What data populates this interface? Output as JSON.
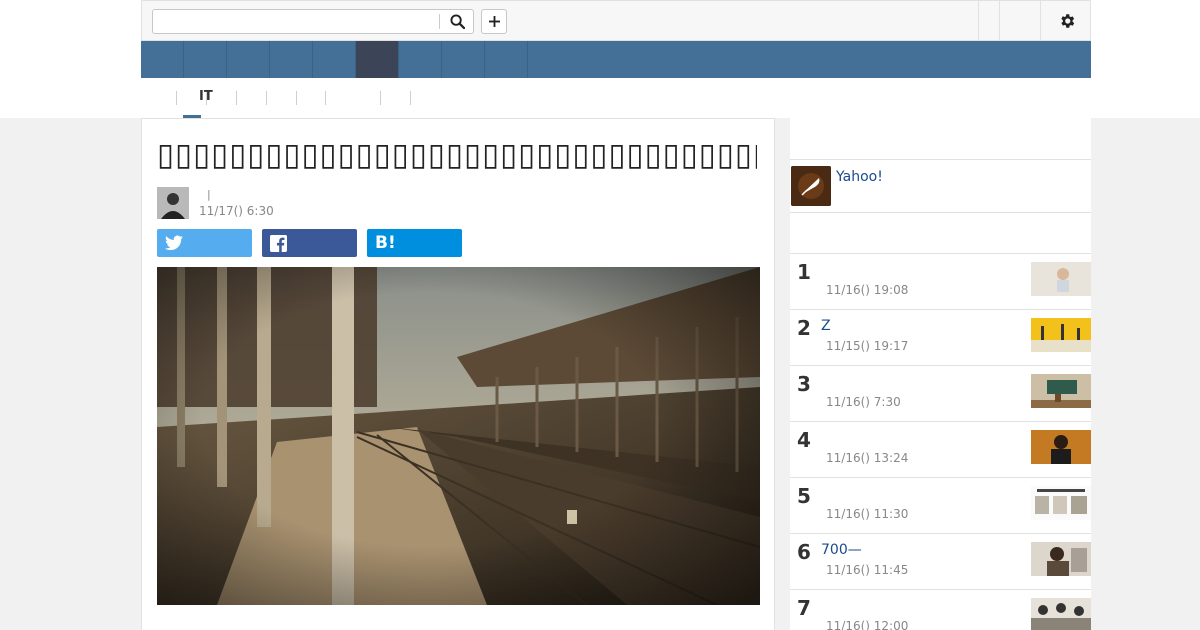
{
  "header": {
    "search_value": "",
    "plus_glyph": "+"
  },
  "subnav": {
    "tab_label": "IT"
  },
  "article": {
    "title": "▯▯▯▯▯▯▯▯▯▯▯▯▯▯▯▯▯▯▯▯▯▯▯▯▯▯▯▯▯▯▯▯▯▯▯▯▯▯▯▯▯▯▯▯▯▯▯",
    "byline_sep": "|",
    "date": "11/17() 6:30",
    "share_hatena": "B!"
  },
  "sidebar": {
    "yahoo_label": "Yahoo!",
    "ranking": [
      {
        "rank": "1",
        "title": "",
        "time": "11/16() 19:08"
      },
      {
        "rank": "2",
        "title": "Z",
        "time": "11/15() 19:17"
      },
      {
        "rank": "3",
        "title": "",
        "time": "11/16() 7:30"
      },
      {
        "rank": "4",
        "title": "",
        "time": "11/16() 13:24"
      },
      {
        "rank": "5",
        "title": "",
        "time": "11/16() 11:30"
      },
      {
        "rank": "6",
        "title": "700—",
        "time": "11/16() 11:45"
      },
      {
        "rank": "7",
        "title": "",
        "time": "11/16() 12:00"
      }
    ]
  },
  "colors": {
    "nav_blue": "#446f97",
    "nav_active": "#3c4558",
    "twitter": "#55acee",
    "facebook": "#3b5998",
    "hatena": "#008fde",
    "link": "#1a4b8f"
  },
  "icons": [
    "search-icon",
    "plus-icon",
    "gear-icon",
    "twitter-icon",
    "facebook-icon",
    "hatena-bookmark-icon",
    "yahoo-news-icon"
  ]
}
